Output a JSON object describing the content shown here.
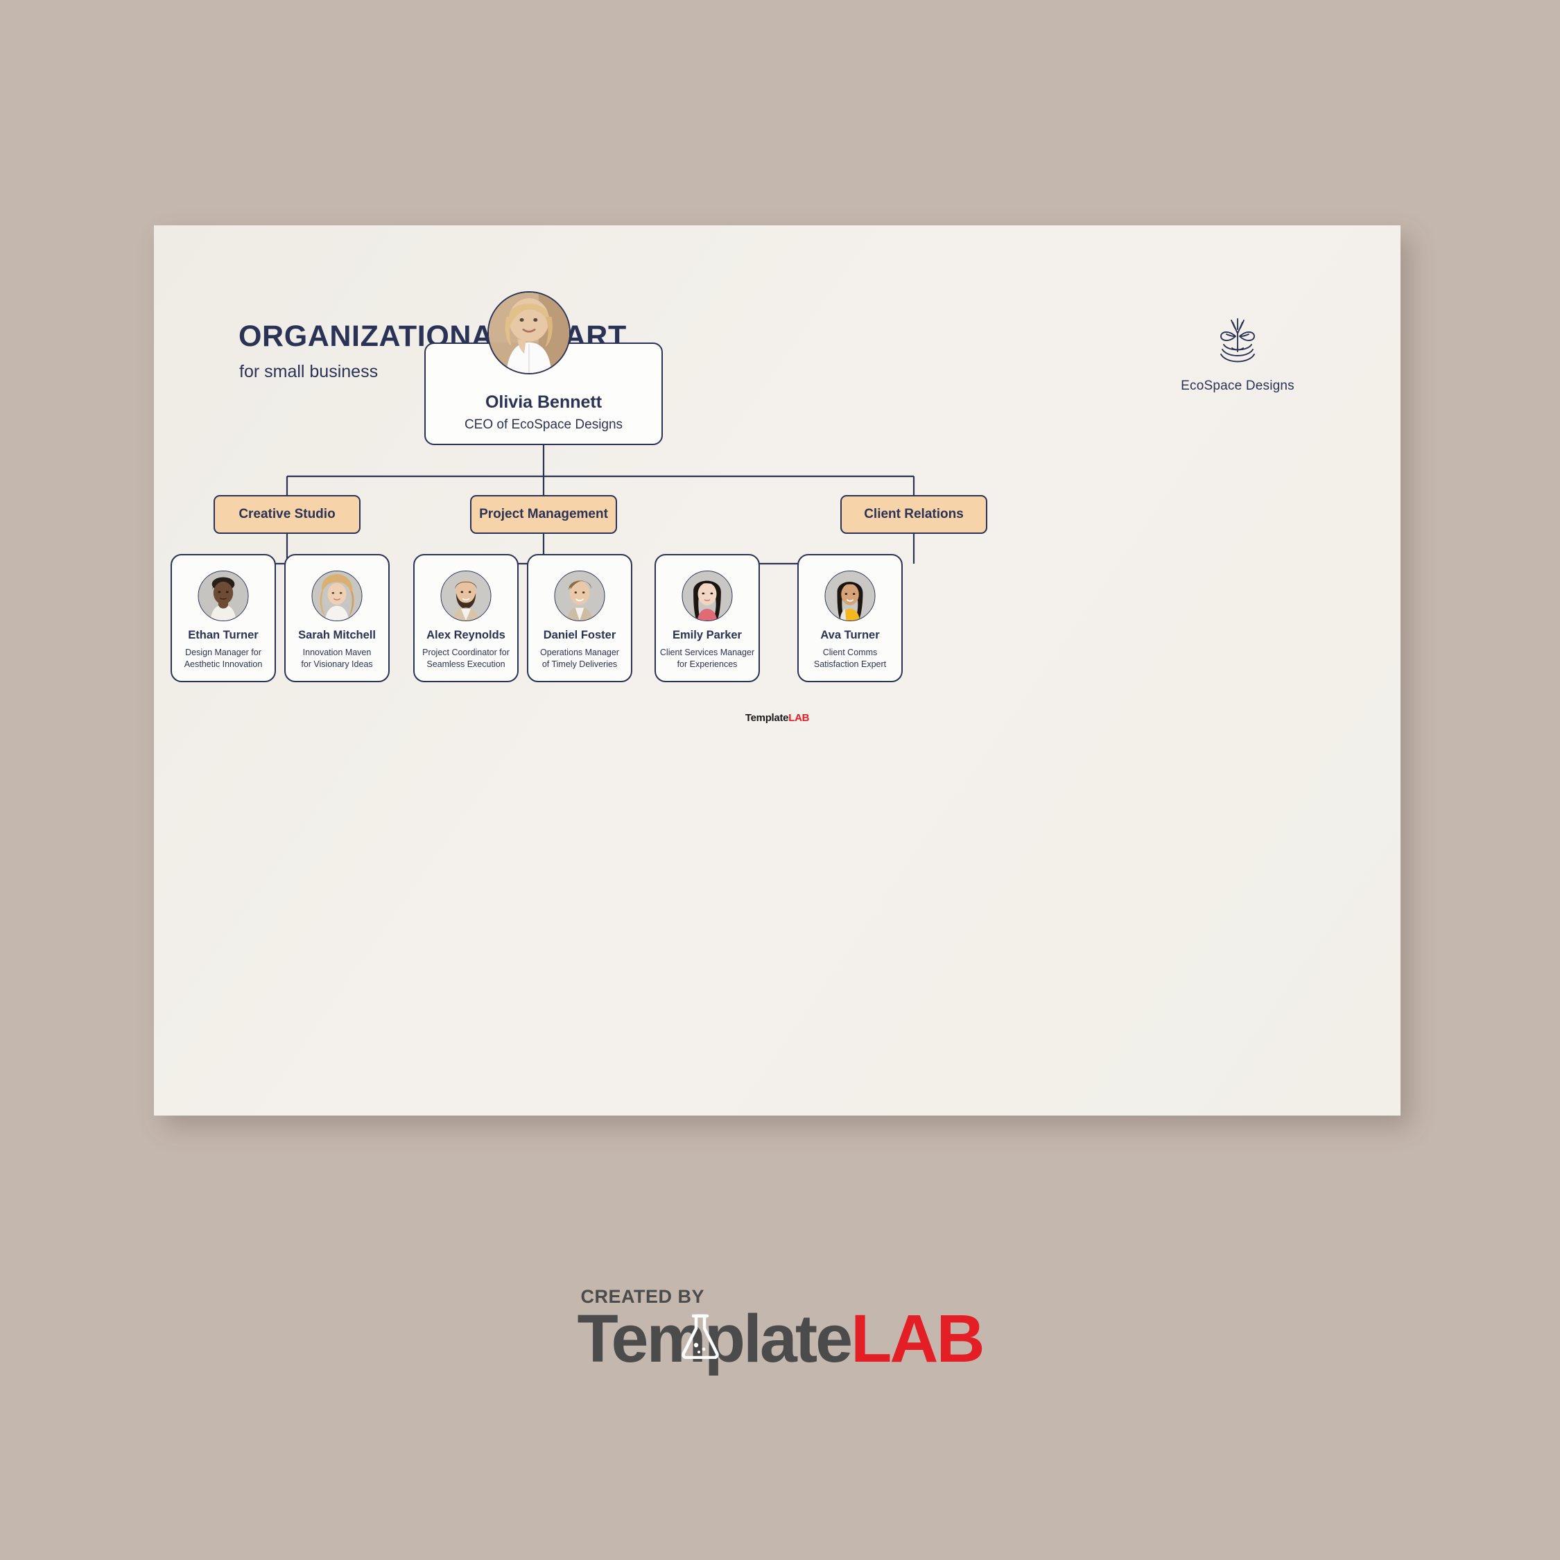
{
  "background_color": "#C4B7AE",
  "page": {
    "background_color": "#F2EFEA",
    "accent_color": "#F6D3A8",
    "line_color": "#2A3256",
    "header": {
      "title": "ORGANIZATIONAL CHART",
      "subtitle": "for small business"
    },
    "brand": {
      "logo_icon": "eco-tree-logo-icon",
      "name": "EcoSpace Designs"
    },
    "watermark": {
      "text_primary": "Template",
      "text_accent": "LAB",
      "accent_color": "#E31E24"
    }
  },
  "chart_data": {
    "type": "diagram",
    "subtype": "organizational-chart",
    "title": "ORGANIZATIONAL CHART",
    "subtitle": "for small business",
    "root": {
      "name": "Olivia Bennett",
      "role": "CEO of EcoSpace Designs",
      "photo": "portrait-blonde-woman-white-shirt"
    },
    "departments": [
      {
        "label": "Creative Studio",
        "members": [
          {
            "name": "Ethan Turner",
            "role_line1": "Design Manager for",
            "role_line2": "Aesthetic Innovation",
            "photo": "portrait-man-short-dark-hair"
          },
          {
            "name": "Sarah Mitchell",
            "role_line1": "Innovation Maven",
            "role_line2": "for Visionary Ideas",
            "photo": "portrait-woman-curly-blonde-hair"
          }
        ]
      },
      {
        "label": "Project Management",
        "members": [
          {
            "name": "Alex Reynolds",
            "role_line1": "Project Coordinator for",
            "role_line2": "Seamless Execution",
            "photo": "portrait-bearded-man"
          },
          {
            "name": "Daniel Foster",
            "role_line1": "Operations Manager",
            "role_line2": "of Timely Deliveries",
            "photo": "portrait-smiling-man-brown-hair"
          }
        ]
      },
      {
        "label": "Client Relations",
        "members": [
          {
            "name": "Emily Parker",
            "role_line1": "Client Services Manager",
            "role_line2": "for Experiences",
            "photo": "portrait-woman-long-black-hair"
          },
          {
            "name": "Ava Turner",
            "role_line1": "Client Comms",
            "role_line2": "Satisfaction Expert",
            "photo": "portrait-woman-yellow-top"
          }
        ]
      }
    ]
  },
  "footer": {
    "created_by": "CREATED BY",
    "brand_primary": "Template",
    "brand_accent": "LAB",
    "flask_icon": "flask-icon"
  }
}
